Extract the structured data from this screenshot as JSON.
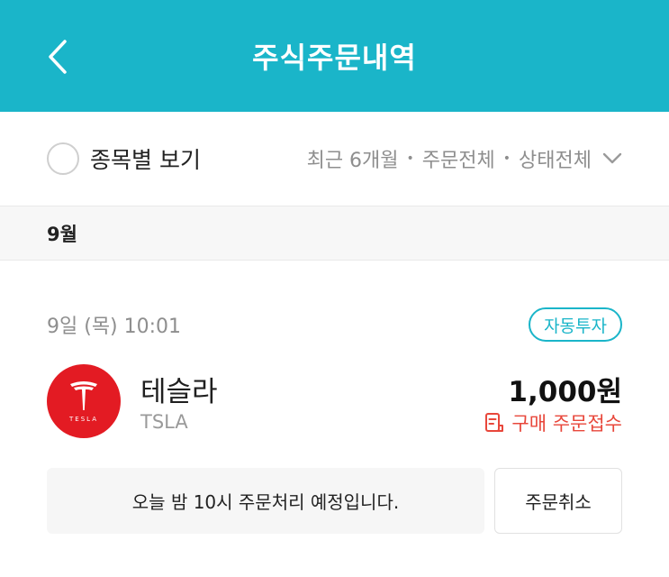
{
  "theme": {
    "accent": "#1ab5c9",
    "status_color": "#e8473b",
    "logo_color": "#e31b23"
  },
  "header": {
    "back_icon": "chevron-left-icon",
    "title": "주식주문내역"
  },
  "filter": {
    "view_by_stock_label": "종목별 보기",
    "view_by_stock_checked": false,
    "period": "최근 6개월",
    "order_type": "주문전체",
    "status": "상태전체",
    "separator": "•",
    "dropdown_icon": "chevron-down-icon"
  },
  "groups": [
    {
      "month": "9월",
      "orders": [
        {
          "datetime": "9일 (목) 10:01",
          "badge": "자동투자",
          "stock_name": "테슬라",
          "ticker": "TSLA",
          "logo_text": "TESLA",
          "amount": "1,000원",
          "status_icon": "receipt-icon",
          "status": "구매 주문접수",
          "notice": "오늘 밤 10시 주문처리 예정입니다.",
          "cancel_label": "주문취소"
        }
      ]
    }
  ]
}
